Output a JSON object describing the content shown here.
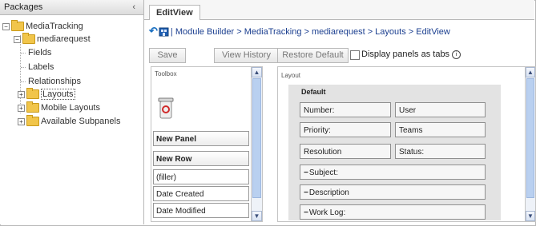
{
  "packages_panel": {
    "title": "Packages",
    "collapse_glyph": "‹",
    "tree": [
      {
        "label": "MediaTracking",
        "icon": "folder-icon",
        "expander": "−"
      },
      {
        "label": "mediarequest",
        "icon": "folder-icon",
        "expander": "−"
      },
      {
        "label": "Fields"
      },
      {
        "label": "Labels"
      },
      {
        "label": "Relationships"
      },
      {
        "label": "Layouts",
        "icon": "folder-icon",
        "expander": "+"
      },
      {
        "label": "Mobile Layouts",
        "icon": "folder-icon",
        "expander": "+"
      },
      {
        "label": "Available Subpanels",
        "icon": "folder-icon",
        "expander": "+"
      }
    ]
  },
  "tab": {
    "label": "EditView"
  },
  "breadcrumb": {
    "text": "| Module Builder > MediaTracking > mediarequest > Layouts > EditView"
  },
  "toolbar": {
    "save": "Save",
    "view_history": "View History",
    "restore_default": "Restore Default",
    "display_tabs": "Display panels as tabs"
  },
  "toolbox": {
    "title": "Toolbox",
    "items": [
      "New Panel",
      "New Row",
      "(filler)",
      "Date Created",
      "Date Modified"
    ]
  },
  "layout": {
    "title": "Layout",
    "panel_title": "Default",
    "fields": [
      "Number:",
      "User",
      "Priority:",
      "Teams",
      "Resolution",
      "Status:",
      "Subject:",
      "Description",
      "Work Log:"
    ]
  },
  "colors": {
    "link": "#1a3e8f",
    "accent": "#f1c54a",
    "panel_bg": "#e3e3e3"
  }
}
